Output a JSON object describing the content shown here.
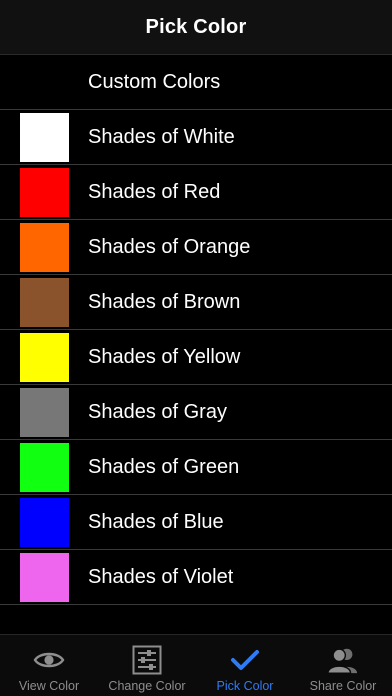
{
  "nav": {
    "title": "Pick Color"
  },
  "colors": {
    "accent": "#2f7bf5",
    "inactive": "#8e8e8e"
  },
  "list": {
    "items": [
      {
        "label": "Custom Colors",
        "swatch": null
      },
      {
        "label": "Shades of White",
        "swatch": "#ffffff"
      },
      {
        "label": "Shades of Red",
        "swatch": "#ff0000"
      },
      {
        "label": "Shades of Orange",
        "swatch": "#ff6600"
      },
      {
        "label": "Shades of Brown",
        "swatch": "#8a532b"
      },
      {
        "label": "Shades of Yellow",
        "swatch": "#ffff00"
      },
      {
        "label": "Shades of Gray",
        "swatch": "#777777"
      },
      {
        "label": "Shades of Green",
        "swatch": "#11ff11"
      },
      {
        "label": "Shades of Blue",
        "swatch": "#0000ff"
      },
      {
        "label": "Shades of Violet",
        "swatch": "#ee66ee"
      }
    ]
  },
  "tabs": [
    {
      "label": "View Color",
      "icon": "eye-icon",
      "active": false
    },
    {
      "label": "Change Color",
      "icon": "sliders-icon",
      "active": false
    },
    {
      "label": "Pick Color",
      "icon": "checkmark-icon",
      "active": true
    },
    {
      "label": "Share Color",
      "icon": "users-icon",
      "active": false
    }
  ]
}
